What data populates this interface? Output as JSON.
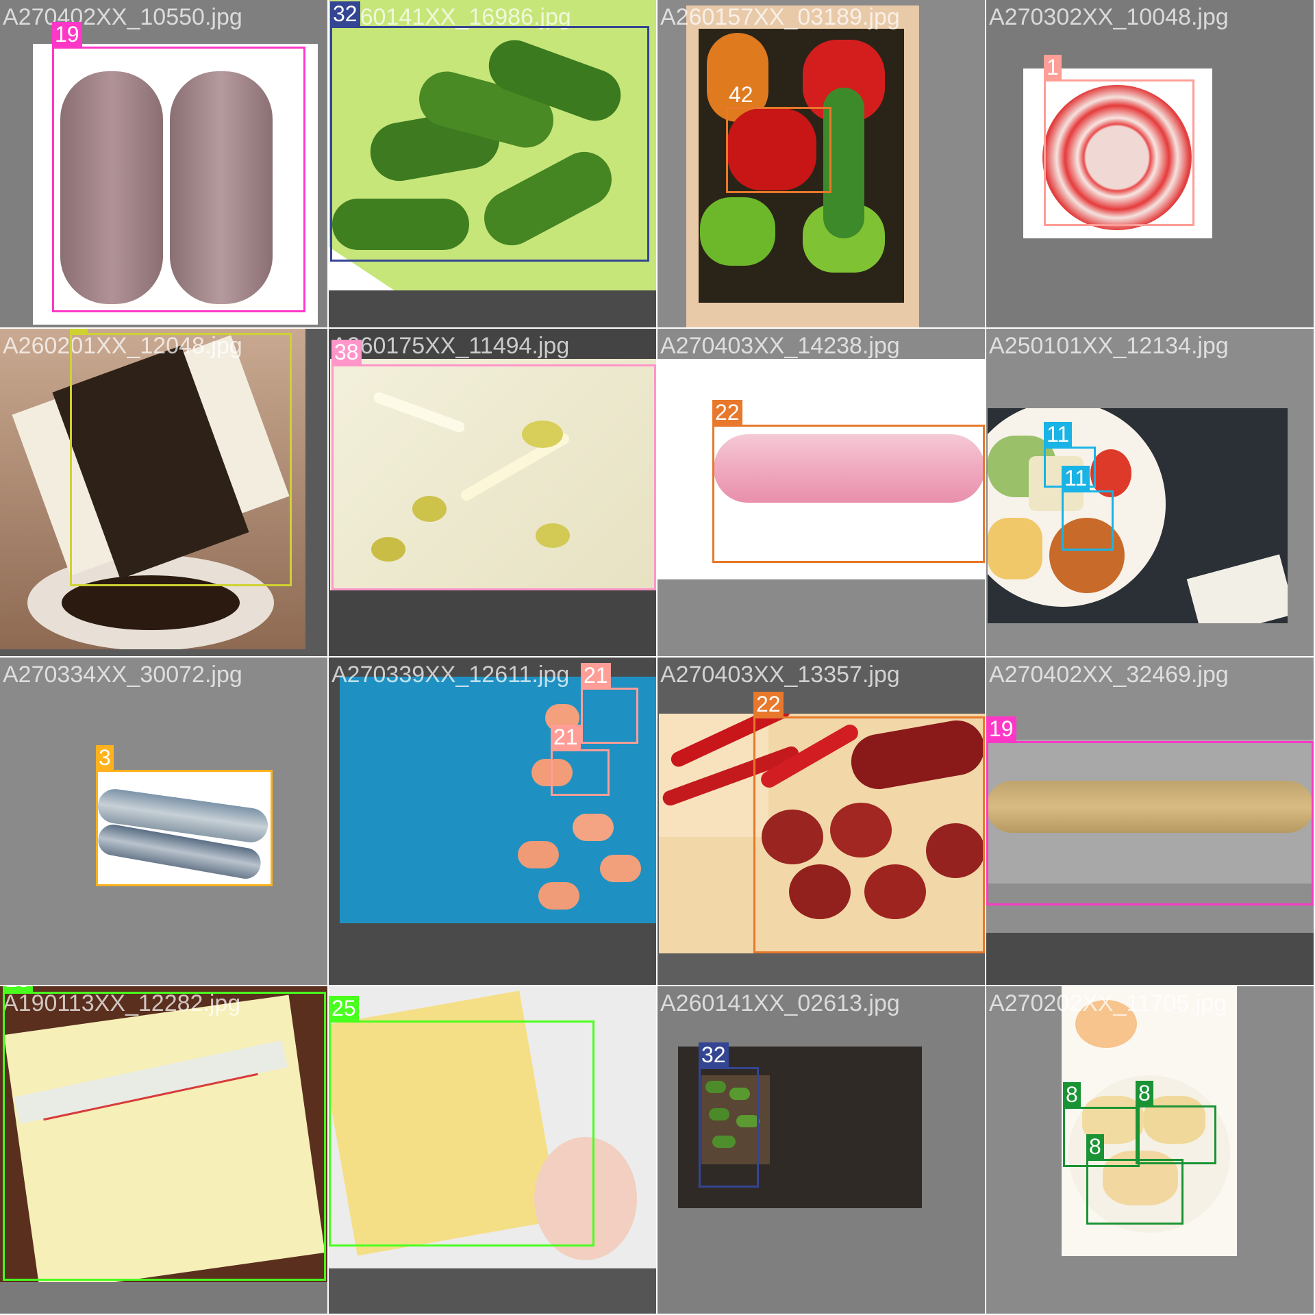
{
  "grid": {
    "tiles": [
      {
        "filename": "A270402XX_10550.jpg",
        "background": "#7f7f7f",
        "labels": [
          {
            "cls": "19",
            "color": "#ff37c7"
          }
        ]
      },
      {
        "filename": "A260141XX_16986.jpg",
        "background": "#4a4a4a",
        "labels": [
          {
            "cls": "32",
            "color": "#344593"
          }
        ]
      },
      {
        "filename": "A260157XX_03189.jpg",
        "background": "#8a8a8a",
        "labels": [
          {
            "cls": "42",
            "color": "#e8782b"
          }
        ]
      },
      {
        "filename": "A270302XX_10048.jpg",
        "background": "#7a7a7a",
        "labels": [
          {
            "cls": "1",
            "color": "#ff9d97"
          }
        ]
      },
      {
        "filename": "A260201XX_12048.jpg",
        "background": "#5a5a5a",
        "labels": [
          {
            "cls": "4",
            "color": "#cfd231"
          }
        ]
      },
      {
        "filename": "A260175XX_11494.jpg",
        "background": "#444444",
        "labels": [
          {
            "cls": "38",
            "color": "#ff95c8"
          }
        ]
      },
      {
        "filename": "A270403XX_14238.jpg",
        "background": "#8a8a8a",
        "labels": [
          {
            "cls": "22",
            "color": "#e8782b"
          }
        ]
      },
      {
        "filename": "A250101XX_12134.jpg",
        "background": "#8c8c8c",
        "labels": [
          {
            "cls": "11",
            "color": "#1ab3e6"
          },
          {
            "cls": "11",
            "color": "#1ab3e6"
          }
        ]
      },
      {
        "filename": "A270334XX_30072.jpg",
        "background": "#8a8a8a",
        "labels": [
          {
            "cls": "3",
            "color": "#ffb21d"
          }
        ]
      },
      {
        "filename": "A270339XX_12611.jpg",
        "background": "#4a4a4a",
        "labels": [
          {
            "cls": "21",
            "color": "#ff9d97"
          },
          {
            "cls": "21",
            "color": "#ff9d97"
          }
        ]
      },
      {
        "filename": "A270403XX_13357.jpg",
        "background": "#5e5e5e",
        "labels": [
          {
            "cls": "22",
            "color": "#e8782b"
          }
        ]
      },
      {
        "filename": "A270402XX_32469.jpg",
        "background": "#8e8e8e",
        "labels": [
          {
            "cls": "19",
            "color": "#ff37c7"
          }
        ]
      },
      {
        "filename": "A190113XX_12282.jpg",
        "background": "#7a7a7a",
        "labels": [
          {
            "cls": "25",
            "color": "#49ff1e"
          }
        ]
      },
      {
        "filename": "",
        "background": "#555555",
        "labels": [
          {
            "cls": "25",
            "color": "#49ff1e"
          }
        ]
      },
      {
        "filename": "A260141XX_02613.jpg",
        "background": "#7f7f7f",
        "labels": [
          {
            "cls": "32",
            "color": "#344593"
          }
        ]
      },
      {
        "filename": "A270202XX_11705.jpg",
        "background": "#8a8a8a",
        "labels": [
          {
            "cls": "8",
            "color": "#1a9334"
          },
          {
            "cls": "8",
            "color": "#1a9334"
          },
          {
            "cls": "8",
            "color": "#1a9334"
          }
        ]
      }
    ]
  }
}
